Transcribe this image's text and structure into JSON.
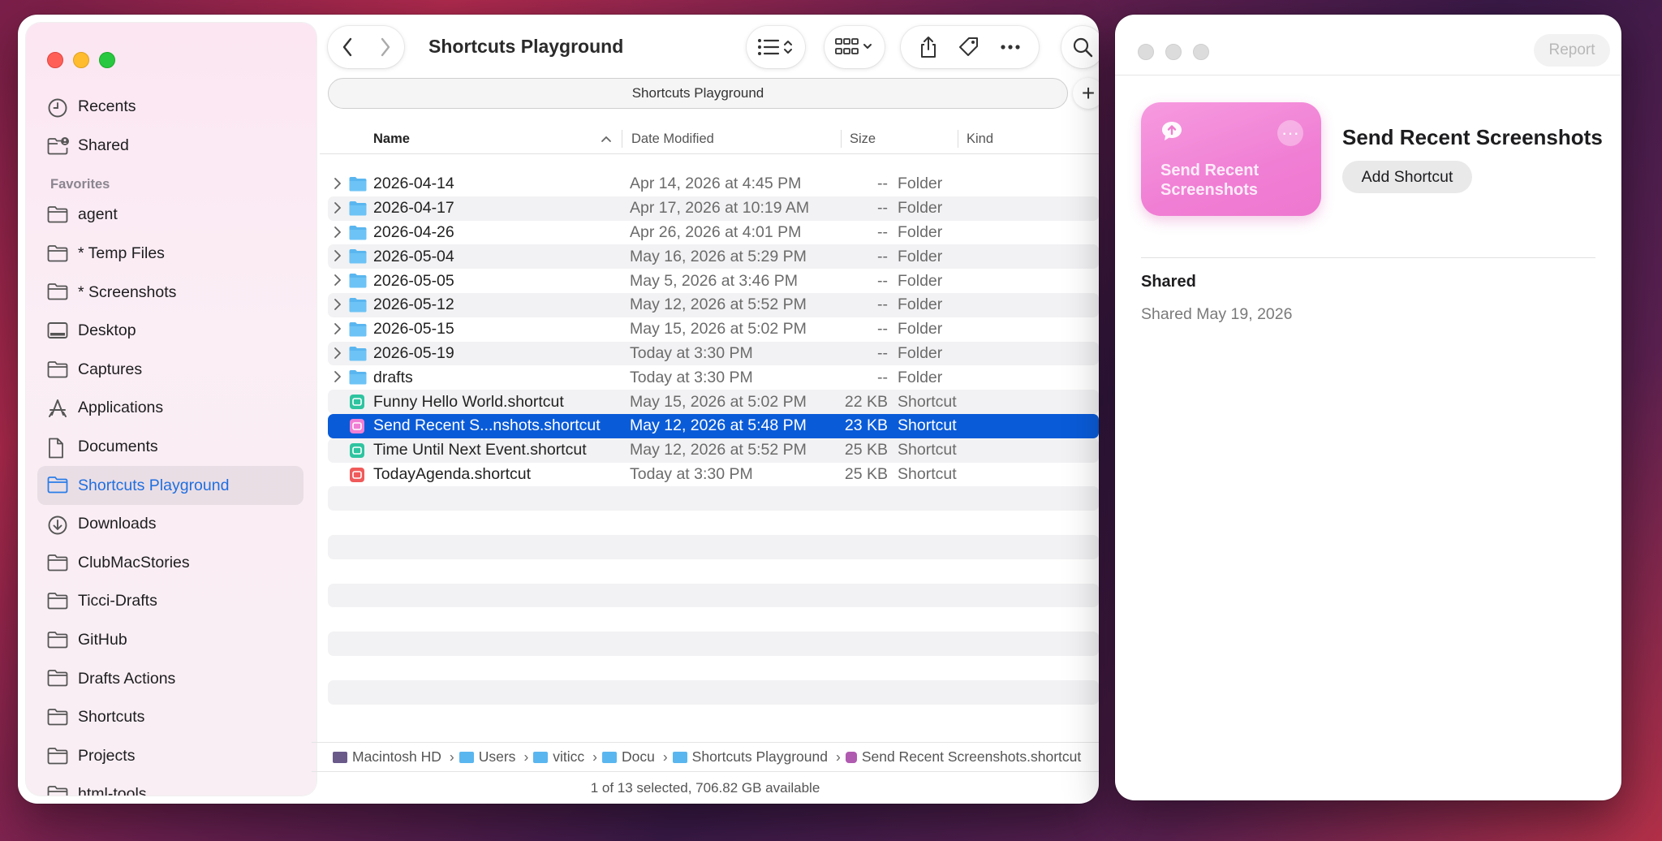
{
  "finder": {
    "title": "Shortcuts Playground",
    "path_bar": "Shortcuts Playground",
    "sidebar": {
      "top_items": [
        {
          "label": "Recents",
          "icon": "clock-icon"
        },
        {
          "label": "Shared",
          "icon": "shared-folder-icon"
        }
      ],
      "favorites_header": "Favorites",
      "favorites": [
        {
          "label": "agent",
          "icon": "folder-icon"
        },
        {
          "label": "* Temp Files",
          "icon": "folder-icon"
        },
        {
          "label": "* Screenshots",
          "icon": "folder-icon"
        },
        {
          "label": "Desktop",
          "icon": "desktop-icon"
        },
        {
          "label": "Captures",
          "icon": "folder-icon"
        },
        {
          "label": "Applications",
          "icon": "applications-icon"
        },
        {
          "label": "Documents",
          "icon": "document-icon"
        },
        {
          "label": "Shortcuts Playground",
          "icon": "folder-icon",
          "active": true
        },
        {
          "label": "Downloads",
          "icon": "download-icon"
        },
        {
          "label": "ClubMacStories",
          "icon": "folder-icon"
        },
        {
          "label": "Ticci-Drafts",
          "icon": "folder-icon"
        },
        {
          "label": "GitHub",
          "icon": "folder-icon"
        },
        {
          "label": "Drafts Actions",
          "icon": "folder-icon"
        },
        {
          "label": "Shortcuts",
          "icon": "folder-icon"
        },
        {
          "label": "Projects",
          "icon": "folder-icon"
        },
        {
          "label": "html-tools",
          "icon": "folder-icon"
        }
      ]
    },
    "columns": {
      "name": "Name",
      "date": "Date Modified",
      "size": "Size",
      "kind": "Kind"
    },
    "rows": [
      {
        "name": "2026-04-14",
        "date": "Apr 14, 2026 at 4:45 PM",
        "size": "--",
        "kind": "Folder",
        "type": "folder"
      },
      {
        "name": "2026-04-17",
        "date": "Apr 17, 2026 at 10:19 AM",
        "size": "--",
        "kind": "Folder",
        "type": "folder"
      },
      {
        "name": "2026-04-26",
        "date": "Apr 26, 2026 at 4:01 PM",
        "size": "--",
        "kind": "Folder",
        "type": "folder"
      },
      {
        "name": "2026-05-04",
        "date": "May 16, 2026 at 5:29 PM",
        "size": "--",
        "kind": "Folder",
        "type": "folder"
      },
      {
        "name": "2026-05-05",
        "date": "May 5, 2026 at 3:46 PM",
        "size": "--",
        "kind": "Folder",
        "type": "folder"
      },
      {
        "name": "2026-05-12",
        "date": "May 12, 2026 at 5:52 PM",
        "size": "--",
        "kind": "Folder",
        "type": "folder"
      },
      {
        "name": "2026-05-15",
        "date": "May 15, 2026 at 5:02 PM",
        "size": "--",
        "kind": "Folder",
        "type": "folder"
      },
      {
        "name": "2026-05-19",
        "date": "Today at 3:30 PM",
        "size": "--",
        "kind": "Folder",
        "type": "folder"
      },
      {
        "name": "drafts",
        "date": "Today at 3:30 PM",
        "size": "--",
        "kind": "Folder",
        "type": "folder"
      },
      {
        "name": "Funny Hello World.shortcut",
        "date": "May 15, 2026 at 5:02 PM",
        "size": "22 KB",
        "kind": "Shortcut",
        "type": "shortcut",
        "color": "#2ec4a0"
      },
      {
        "name": "Send Recent S...nshots.shortcut",
        "date": "May 12, 2026 at 5:48 PM",
        "size": "23 KB",
        "kind": "Shortcut",
        "type": "shortcut",
        "color": "#f07fd4",
        "selected": true
      },
      {
        "name": "Time Until Next Event.shortcut",
        "date": "May 12, 2026 at 5:52 PM",
        "size": "25 KB",
        "kind": "Shortcut",
        "type": "shortcut",
        "color": "#2ec4a0"
      },
      {
        "name": "TodayAgenda.shortcut",
        "date": "Today at 3:30 PM",
        "size": "25 KB",
        "kind": "Shortcut",
        "type": "shortcut",
        "color": "#f05a5a"
      }
    ],
    "breadcrumb": [
      {
        "label": "Macintosh HD",
        "icon": "hard-drive-icon"
      },
      {
        "label": "Users",
        "icon": "folder-icon"
      },
      {
        "label": "viticc",
        "icon": "home-folder-icon"
      },
      {
        "label": "Docu",
        "icon": "folder-icon"
      },
      {
        "label": "Shortcuts Playground",
        "icon": "folder-icon"
      },
      {
        "label": "Send Recent Screenshots.shortcut",
        "icon": "shortcut-file-icon"
      }
    ],
    "status": "1 of 13 selected, 706.82 GB available"
  },
  "shortcut_window": {
    "report_label": "Report",
    "card_name": "Send Recent Screenshots",
    "title": "Send Recent Screenshots",
    "add_label": "Add Shortcut",
    "shared_header": "Shared",
    "shared_text": "Shared May 19, 2026"
  },
  "colors": {
    "accent": "#0a5bd8",
    "sidebar_active_text": "#1f6fe0",
    "shortcut_card": "#f07fd4"
  }
}
